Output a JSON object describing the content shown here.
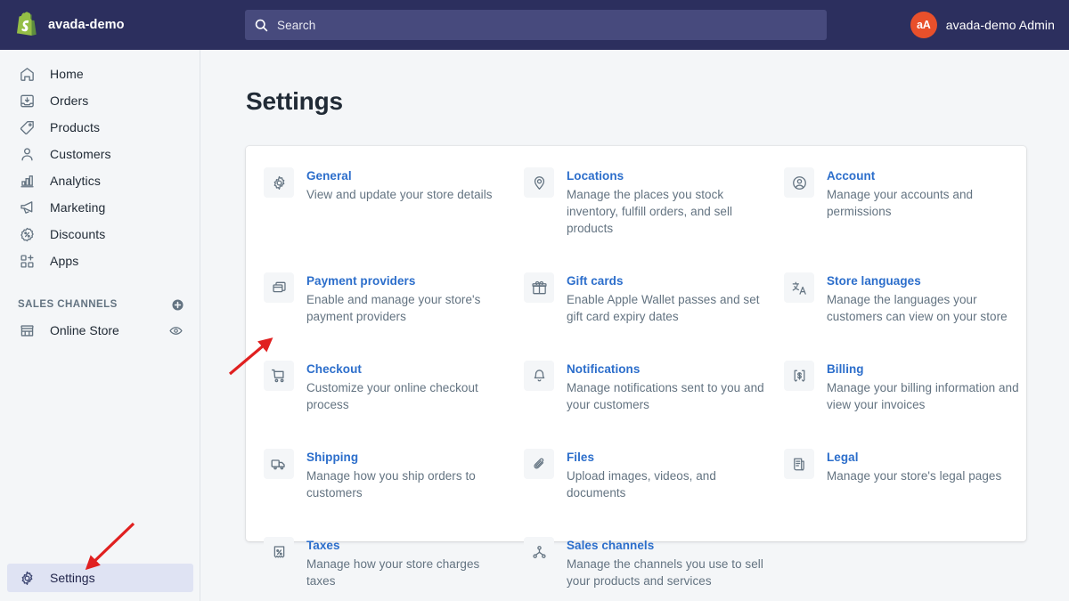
{
  "topbar": {
    "logo_icon": "shopify-bag-icon",
    "store_name": "avada-demo",
    "search": {
      "icon": "search-icon",
      "placeholder": "Search",
      "value": ""
    },
    "user": {
      "avatar_initials": "aA",
      "name": "avada-demo Admin",
      "avatar_color": "#e8502b"
    },
    "background_color": "#2c2f5e"
  },
  "sidebar": {
    "items": [
      {
        "label": "Home",
        "icon": "home-icon",
        "active": false
      },
      {
        "label": "Orders",
        "icon": "orders-inbox-icon",
        "active": false
      },
      {
        "label": "Products",
        "icon": "product-tag-icon",
        "active": false
      },
      {
        "label": "Customers",
        "icon": "customer-person-icon",
        "active": false
      },
      {
        "label": "Analytics",
        "icon": "analytics-bar-chart-icon",
        "active": false
      },
      {
        "label": "Marketing",
        "icon": "marketing-megaphone-icon",
        "active": false
      },
      {
        "label": "Discounts",
        "icon": "discount-percent-badge-icon",
        "active": false
      },
      {
        "label": "Apps",
        "icon": "apps-grid-plus-icon",
        "active": false
      }
    ],
    "sales_channels": {
      "title": "SALES CHANNELS",
      "add_icon": "plus-circle-icon",
      "channels": [
        {
          "label": "Online Store",
          "icon": "storefront-icon",
          "action_icon": "eye-icon"
        }
      ]
    },
    "settings": {
      "label": "Settings",
      "icon": "gear-icon",
      "active": true,
      "highlight_color": "#dfe3f3"
    }
  },
  "main": {
    "page_title": "Settings",
    "columns": [
      {
        "entries": [
          {
            "icon": "gear-icon",
            "title": "General",
            "description": "View and update your store details"
          },
          {
            "icon": "payment-card-icon",
            "title": "Payment providers",
            "description": "Enable and manage your store's payment providers"
          },
          {
            "icon": "shopping-cart-icon",
            "title": "Checkout",
            "description": "Customize your online checkout process"
          },
          {
            "icon": "shipping-truck-icon",
            "title": "Shipping",
            "description": "Manage how you ship orders to customers"
          },
          {
            "icon": "tax-receipt-percent-icon",
            "title": "Taxes",
            "description": "Manage how your store charges taxes"
          }
        ]
      },
      {
        "entries": [
          {
            "icon": "location-pin-icon",
            "title": "Locations",
            "description": "Manage the places you stock inventory, fulfill orders, and sell products"
          },
          {
            "icon": "gift-card-icon",
            "title": "Gift cards",
            "description": "Enable Apple Wallet passes and set gift card expiry dates"
          },
          {
            "icon": "notification-bell-icon",
            "title": "Notifications",
            "description": "Manage notifications sent to you and your customers"
          },
          {
            "icon": "paperclip-files-icon",
            "title": "Files",
            "description": "Upload images, videos, and documents"
          },
          {
            "icon": "sales-channels-network-icon",
            "title": "Sales channels",
            "description": "Manage the channels you use to sell your products and services"
          }
        ]
      },
      {
        "entries": [
          {
            "icon": "account-circle-person-icon",
            "title": "Account",
            "description": "Manage your accounts and permissions"
          },
          {
            "icon": "translate-languages-icon",
            "title": "Store languages",
            "description": "Manage the languages your customers can view on your store"
          },
          {
            "icon": "billing-receipt-dollar-icon",
            "title": "Billing",
            "description": "Manage your billing information and view your invoices"
          },
          {
            "icon": "legal-document-icon",
            "title": "Legal",
            "description": "Manage your store's legal pages"
          }
        ]
      }
    ]
  },
  "annotations": {
    "arrow_color": "#e02020",
    "arrows": [
      {
        "name": "arrow-pointing-to-checkout",
        "target": "Checkout"
      },
      {
        "name": "arrow-pointing-to-settings",
        "target": "Settings"
      }
    ]
  }
}
